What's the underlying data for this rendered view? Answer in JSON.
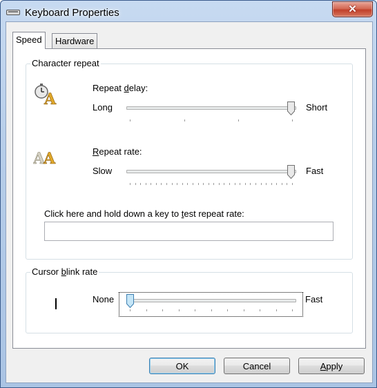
{
  "window": {
    "title": "Keyboard Properties",
    "close_glyph": "✕"
  },
  "tabs": [
    {
      "label": "Speed",
      "active": true
    },
    {
      "label": "Hardware",
      "active": false
    }
  ],
  "character_repeat": {
    "group_title": "Character repeat",
    "delay": {
      "label_pre": "Repeat ",
      "label_key": "d",
      "label_post": "elay:",
      "min_label": "Long",
      "max_label": "Short",
      "value": 1.0,
      "icon": "stopwatch-letter-a-icon"
    },
    "rate": {
      "label_pre": "",
      "label_key": "R",
      "label_post": "epeat rate:",
      "min_label": "Slow",
      "max_label": "Fast",
      "value": 1.0,
      "icon": "double-letter-a-icon"
    },
    "test": {
      "label_pre": "Click here and hold down a key to ",
      "label_key": "t",
      "label_post": "est repeat rate:",
      "value": ""
    }
  },
  "cursor_blink": {
    "group_title_pre": "Cursor ",
    "group_title_key": "b",
    "group_title_post": "link rate",
    "min_label": "None",
    "max_label": "Fast",
    "value": 0.0
  },
  "buttons": {
    "ok": "OK",
    "cancel": "Cancel",
    "apply_key": "A",
    "apply_rest": "pply"
  },
  "colors": {
    "accent": "#3c7fb1",
    "close": "#c1402a"
  }
}
